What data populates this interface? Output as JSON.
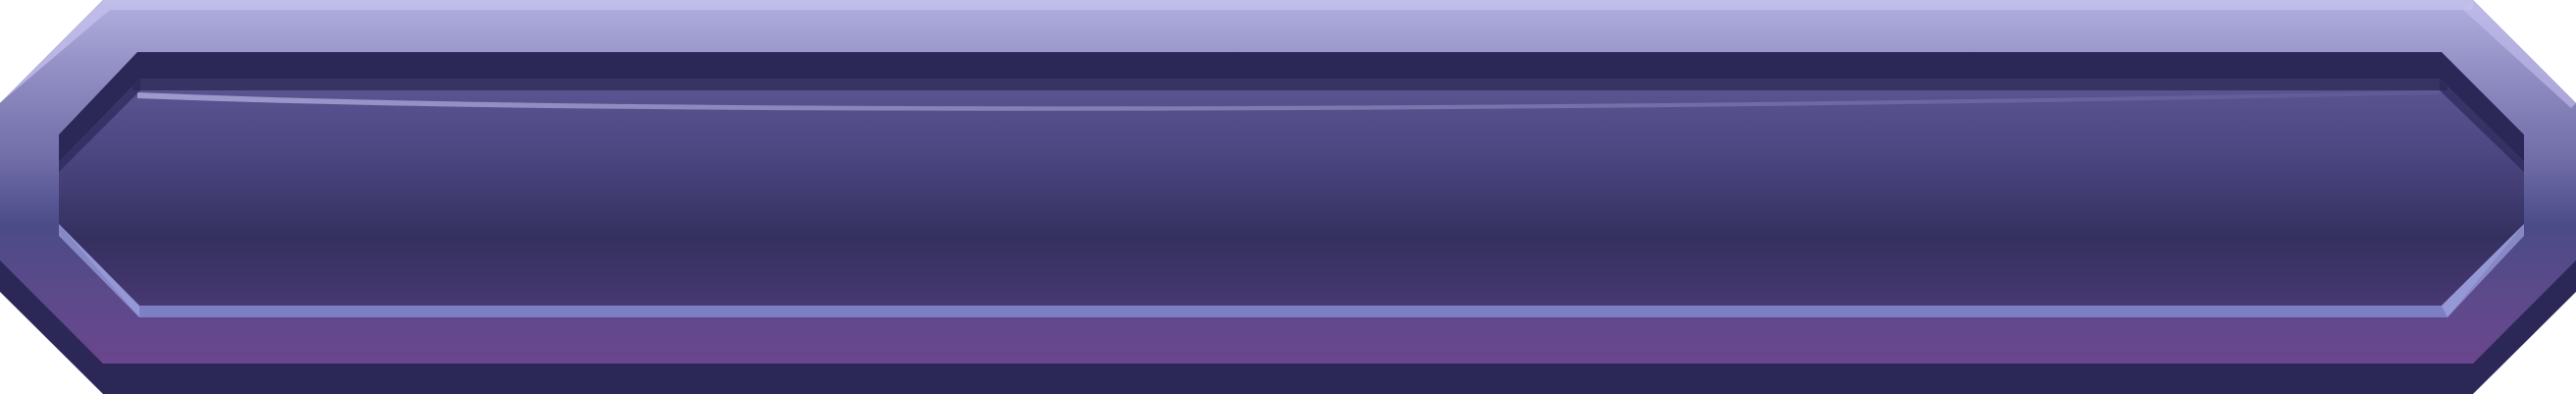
{
  "panel": {
    "label": "",
    "colors": {
      "frame_top": "#A8A6D8",
      "frame_mid": "#6F6DA8",
      "frame_bottom": "#6B4A8E",
      "shadow": "#2B2858",
      "inner_top": "#5A5590",
      "inner_mid": "#34305E",
      "inner_bottom": "#463770",
      "inner_rim": "#7C7FC4",
      "highlight": "#C8C6F0"
    }
  }
}
